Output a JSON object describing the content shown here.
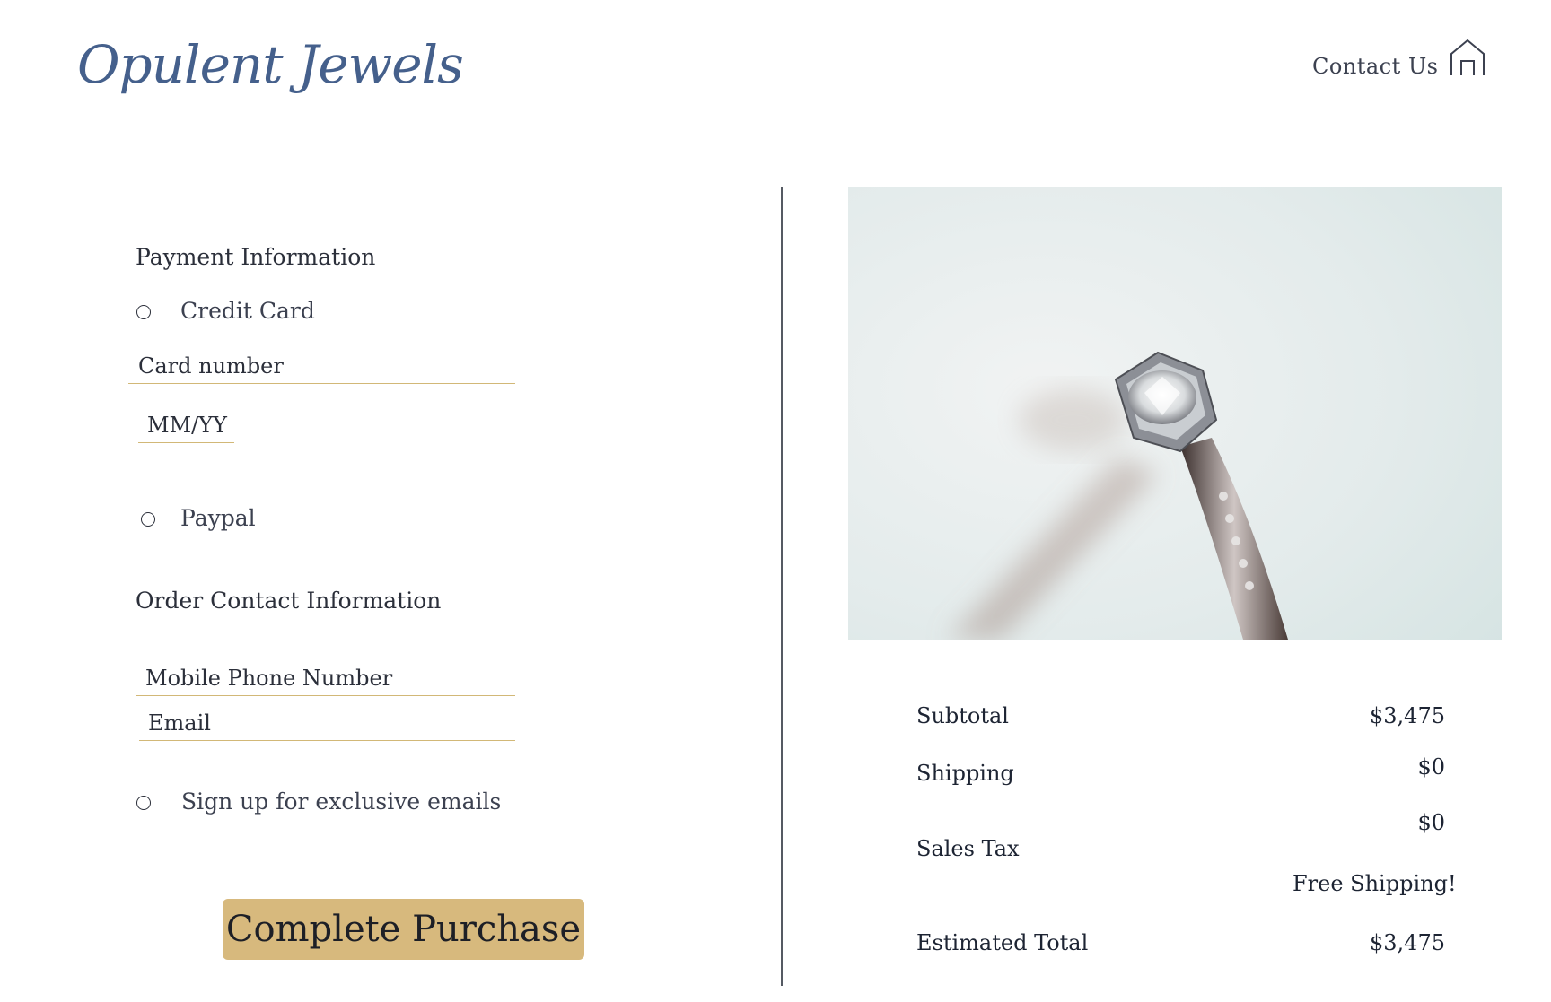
{
  "header": {
    "brand": "Opulent Jewels",
    "contact_label": "Contact Us",
    "home_icon": "home-icon"
  },
  "payment": {
    "title": "Payment Information",
    "credit_card_label": "Credit Card",
    "card_number_placeholder": "Card number",
    "expiry_placeholder": "MM/YY",
    "paypal_label": "Paypal"
  },
  "contact": {
    "title": "Order Contact Information",
    "phone_placeholder": "Mobile Phone Number",
    "email_placeholder": "Email",
    "signup_label": "Sign up for exclusive emails"
  },
  "purchase_button": "Complete Purchase",
  "summary": {
    "subtotal_label": "Subtotal",
    "subtotal_value": "$3,475",
    "shipping_label": "Shipping",
    "shipping_value": "$0",
    "tax_label": "Sales Tax",
    "tax_value": "$0",
    "free_shipping_note": "Free Shipping!",
    "total_label": "Estimated Total",
    "total_value": "$3,475"
  },
  "colors": {
    "brand_blue": "#45608c",
    "gold_accent": "#d7b97d",
    "gold_rule": "#d8c597",
    "text_dark": "#2b2f3a"
  }
}
